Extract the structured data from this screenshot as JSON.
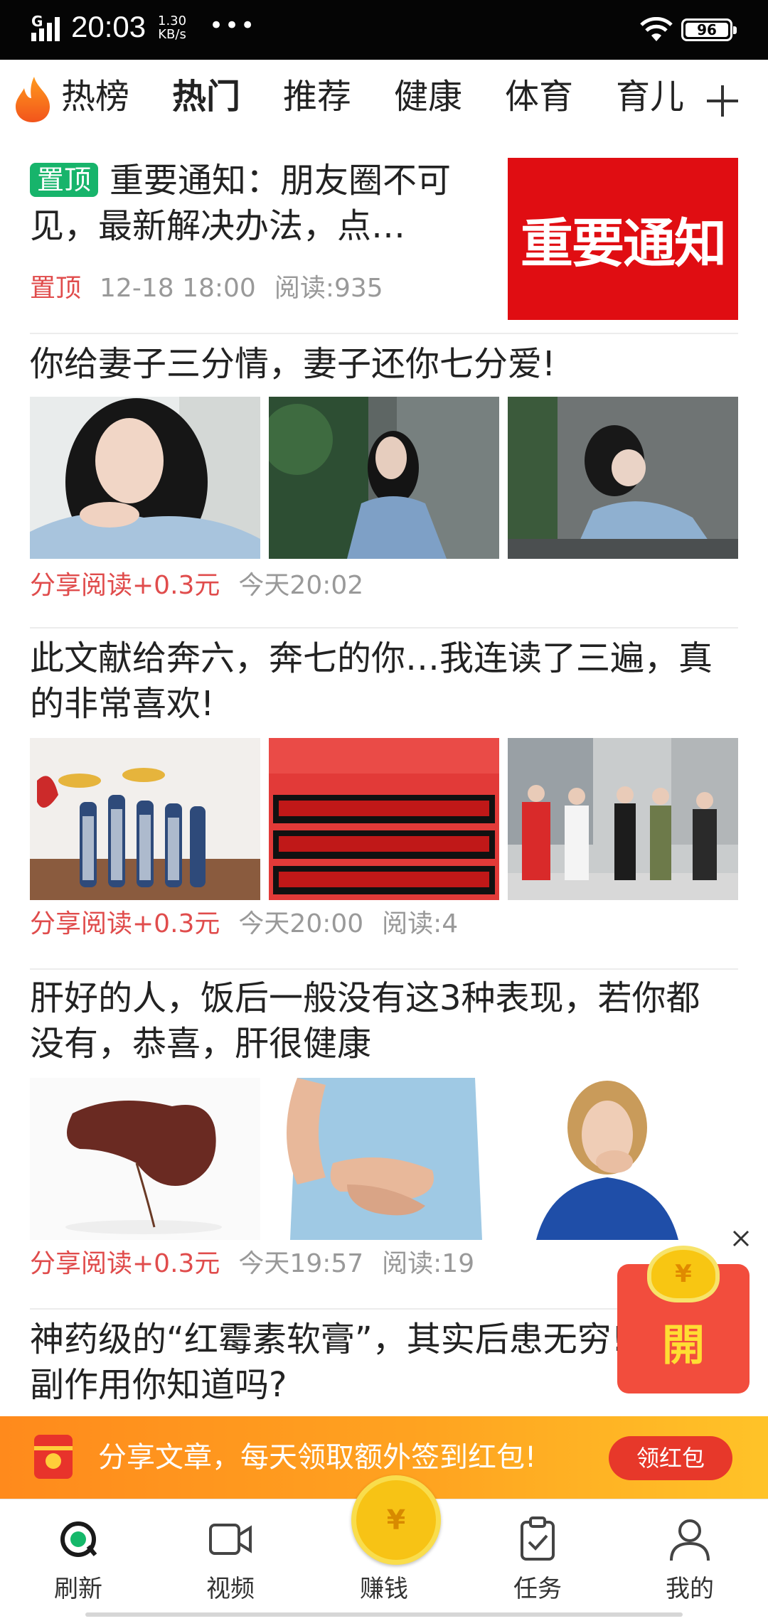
{
  "status_bar": {
    "network": "G",
    "time": "20:03",
    "speed_value": "1.30",
    "speed_unit": "KB/s",
    "more": "•••",
    "battery": "96"
  },
  "tabs": [
    {
      "label": "热榜",
      "active": false
    },
    {
      "label": "热门",
      "active": true
    },
    {
      "label": "推荐",
      "active": false
    },
    {
      "label": "健康",
      "active": false
    },
    {
      "label": "体育",
      "active": false
    },
    {
      "label": "育儿",
      "active": false
    }
  ],
  "articles": [
    {
      "badge": "置顶",
      "title": "重要通知：朋友圈不可见，最新解决办法，点…",
      "meta_tag": "置顶",
      "date": "12-18 18:00",
      "reads": "阅读:935",
      "image_text": "重要通知"
    },
    {
      "title": "你给妻子三分情，妻子还你七分爱!",
      "meta_tag": "分享阅读+0.3元",
      "date": "今天20:02"
    },
    {
      "title": "此文献给奔六，奔七的你…我连读了三遍，真的非常喜欢!",
      "meta_tag": "分享阅读+0.3元",
      "date": "今天20:00",
      "reads": "阅读:4"
    },
    {
      "title": "肝好的人，饭后一般没有这3种表现，若你都没有，恭喜，肝很健康",
      "meta_tag": "分享阅读+0.3元",
      "date": "今天19:57",
      "reads": "阅读:19"
    },
    {
      "title": "神药级的“红霉素软膏”，其实后患无穷!3个副作用你知道吗?"
    }
  ],
  "red_packet": {
    "coin_symbol": "¥",
    "label": "開"
  },
  "banner": {
    "text": "分享文章，每天领取额外签到红包!",
    "button": "领红包"
  },
  "bottom_nav": [
    {
      "label": "刷新",
      "icon": "refresh-icon"
    },
    {
      "label": "视频",
      "icon": "video-icon"
    },
    {
      "label": "赚钱",
      "icon": "coin-icon",
      "coin_symbol": "¥"
    },
    {
      "label": "任务",
      "icon": "task-clipboard-icon"
    },
    {
      "label": "我的",
      "icon": "profile-icon"
    }
  ],
  "colors": {
    "accent_green": "#15b86a",
    "meta_red": "#e04c4c",
    "notice_red": "#e00d12",
    "banner_orange": "#ffa320",
    "coin_gold": "#f7c315"
  }
}
